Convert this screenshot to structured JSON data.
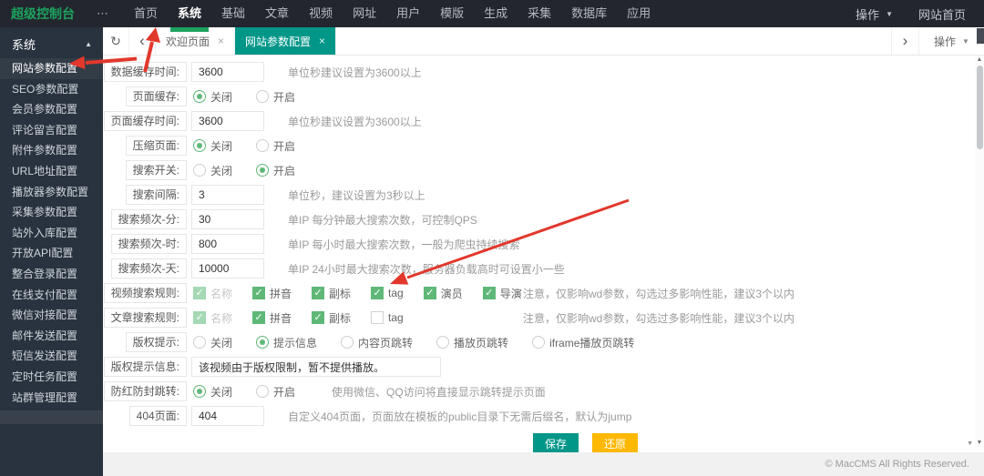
{
  "topbar": {
    "logo": "超级控制台",
    "nav": [
      {
        "label": "首页"
      },
      {
        "label": "系统",
        "active": true
      },
      {
        "label": "基础"
      },
      {
        "label": "文章"
      },
      {
        "label": "视频"
      },
      {
        "label": "网址"
      },
      {
        "label": "用户"
      },
      {
        "label": "模版"
      },
      {
        "label": "生成"
      },
      {
        "label": "采集"
      },
      {
        "label": "数据库"
      },
      {
        "label": "应用"
      }
    ],
    "right": {
      "action": "操作",
      "home": "网站首页"
    }
  },
  "sidebar": {
    "group": "系统",
    "items": [
      {
        "label": "网站参数配置",
        "active": true
      },
      {
        "label": "SEO参数配置"
      },
      {
        "label": "会员参数配置"
      },
      {
        "label": "评论留言配置"
      },
      {
        "label": "附件参数配置"
      },
      {
        "label": "URL地址配置"
      },
      {
        "label": "播放器参数配置"
      },
      {
        "label": "采集参数配置"
      },
      {
        "label": "站外入库配置"
      },
      {
        "label": "开放API配置"
      },
      {
        "label": "整合登录配置"
      },
      {
        "label": "在线支付配置"
      },
      {
        "label": "微信对接配置"
      },
      {
        "label": "邮件发送配置"
      },
      {
        "label": "短信发送配置"
      },
      {
        "label": "定时任务配置"
      },
      {
        "label": "站群管理配置"
      }
    ]
  },
  "tabbar": {
    "tabs": [
      {
        "label": "欢迎页面"
      },
      {
        "label": "网站参数配置",
        "active": true
      }
    ],
    "action": "操作"
  },
  "form": {
    "rows": [
      {
        "type": "input",
        "label": "数据缓存时间:",
        "value": "3600",
        "hint": "单位秒建议设置为3600以上"
      },
      {
        "type": "radio",
        "label": "页面缓存:",
        "options": [
          {
            "label": "关闭",
            "selected": true
          },
          {
            "label": "开启",
            "selected": false
          }
        ]
      },
      {
        "type": "input",
        "label": "页面缓存时间:",
        "value": "3600",
        "hint": "单位秒建议设置为3600以上"
      },
      {
        "type": "radio",
        "label": "压缩页面:",
        "options": [
          {
            "label": "关闭",
            "selected": true
          },
          {
            "label": "开启",
            "selected": false
          }
        ]
      },
      {
        "type": "radio",
        "label": "搜索开关:",
        "options": [
          {
            "label": "关闭",
            "selected": false
          },
          {
            "label": "开启",
            "selected": true
          }
        ]
      },
      {
        "type": "input",
        "label": "搜索间隔:",
        "value": "3",
        "hint": "单位秒，建议设置为3秒以上"
      },
      {
        "type": "input",
        "label": "搜索频次-分:",
        "value": "30",
        "hint": "单IP 每分钟最大搜索次数，可控制QPS"
      },
      {
        "type": "input",
        "label": "搜索频次-时:",
        "value": "800",
        "hint": "单IP 每小时最大搜索次数，一般为爬虫持续搜索"
      },
      {
        "type": "input",
        "label": "搜索频次-天:",
        "value": "10000",
        "hint": "单IP 24小时最大搜索次数，服务器负载高时可设置小一些"
      },
      {
        "type": "checkbox",
        "label": "视频搜索规则:",
        "hint": "注意，仅影响wd参数，勾选过多影响性能，建议3个以内",
        "items": [
          {
            "label": "名称",
            "checked": true,
            "disabled": true
          },
          {
            "label": "拼音",
            "checked": true
          },
          {
            "label": "副标",
            "checked": true
          },
          {
            "label": "tag",
            "checked": true
          },
          {
            "label": "演员",
            "checked": true
          },
          {
            "label": "导演",
            "checked": true
          }
        ]
      },
      {
        "type": "checkbox",
        "label": "文章搜索规则:",
        "hint": "注意，仅影响wd参数，勾选过多影响性能，建议3个以内",
        "items": [
          {
            "label": "名称",
            "checked": true,
            "disabled": true
          },
          {
            "label": "拼音",
            "checked": true
          },
          {
            "label": "副标",
            "checked": true
          },
          {
            "label": "tag",
            "checked": false
          }
        ]
      },
      {
        "type": "radio",
        "label": "版权提示:",
        "options": [
          {
            "label": "关闭",
            "selected": false
          },
          {
            "label": "提示信息",
            "selected": true
          },
          {
            "label": "内容页跳转",
            "selected": false
          },
          {
            "label": "播放页跳转",
            "selected": false
          },
          {
            "label": "iframe播放页跳转",
            "selected": false
          }
        ]
      },
      {
        "type": "input",
        "label": "版权提示信息:",
        "value": "该视频由于版权限制，暂不提供播放。",
        "hint": ""
      },
      {
        "type": "radio",
        "label": "防红防封跳转:",
        "hint": "使用微信、QQ访问将直接显示跳转提示页面",
        "options": [
          {
            "label": "关闭",
            "selected": true
          },
          {
            "label": "开启",
            "selected": false
          }
        ]
      },
      {
        "type": "input",
        "label": "404页面:",
        "value": "404",
        "hint": "自定义404页面，页面放在模板的public目录下无需后缀名，默认为jump"
      }
    ],
    "buttons": {
      "save": "保存",
      "reset": "还原"
    }
  },
  "footer": {
    "copyright": "© MacCMS All Rights Reserved."
  },
  "icons": {
    "more": "⋯",
    "caret_down": "▼",
    "caret_up": "▲",
    "refresh": "↻",
    "chevron_left": "‹",
    "chevron_right": "›",
    "close": "×",
    "scroll_up": "▲",
    "scroll_down": "▼"
  },
  "colors": {
    "brand_green": "#1CA25F",
    "active_tab_teal": "#009688",
    "control_green": "#5FB878",
    "save_button": "#009688",
    "reset_button": "#FFB800",
    "annotation_red": "#E2382C",
    "topbar_bg": "#23262E",
    "sidebar_bg": "#29333F"
  }
}
